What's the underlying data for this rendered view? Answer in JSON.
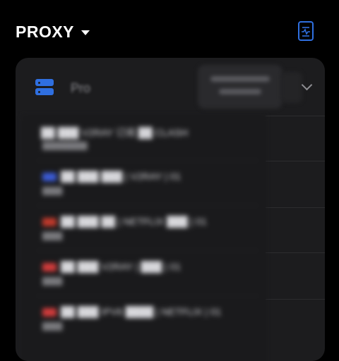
{
  "header": {
    "title": "PROXY"
  },
  "colors": {
    "accent": "#2f6fe0",
    "card": "#1c1c1e",
    "background": "#000000"
  },
  "group": {
    "icon": "server-icon",
    "name": "Pro",
    "selected": {
      "line1": "████",
      "line2": "███"
    }
  },
  "proxies": [
    {
      "name": "██ ███ V2RAY 订阅 ██ CLASH",
      "sub": "█████████",
      "flag": ""
    },
    {
      "name": "██ ███ ███ | V2RAY | 01",
      "sub": "████",
      "flag": "#3b5bd6"
    },
    {
      "name": "██ ███ ██ | NETFLIX ███ | 01",
      "sub": "████",
      "flag": "#c0392b"
    },
    {
      "name": "██ ███ V2RAY | ███ | 01",
      "sub": "████",
      "flag": "#d13b3b"
    },
    {
      "name": "██ ███ IPV6 ████ | NETFLIX | 01",
      "sub": "████",
      "flag": "#d13b3b"
    }
  ]
}
